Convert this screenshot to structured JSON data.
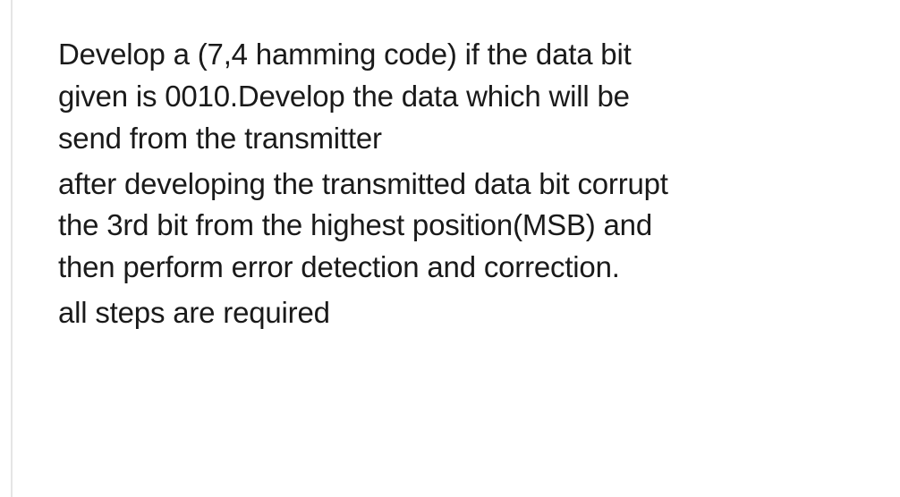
{
  "question": {
    "para1_line1": "Develop a (7,4 hamming code) if the data bit",
    "para1_line2": "given is 0010.Develop the data which will be",
    "para1_line3": "send from the transmitter",
    "para2_line1": "after developing the transmitted data bit corrupt",
    "para2_line2": "the 3rd bit from the highest position(MSB) and",
    "para2_line3": "then perform error detection and correction.",
    "para3_line1": "all steps are required"
  }
}
